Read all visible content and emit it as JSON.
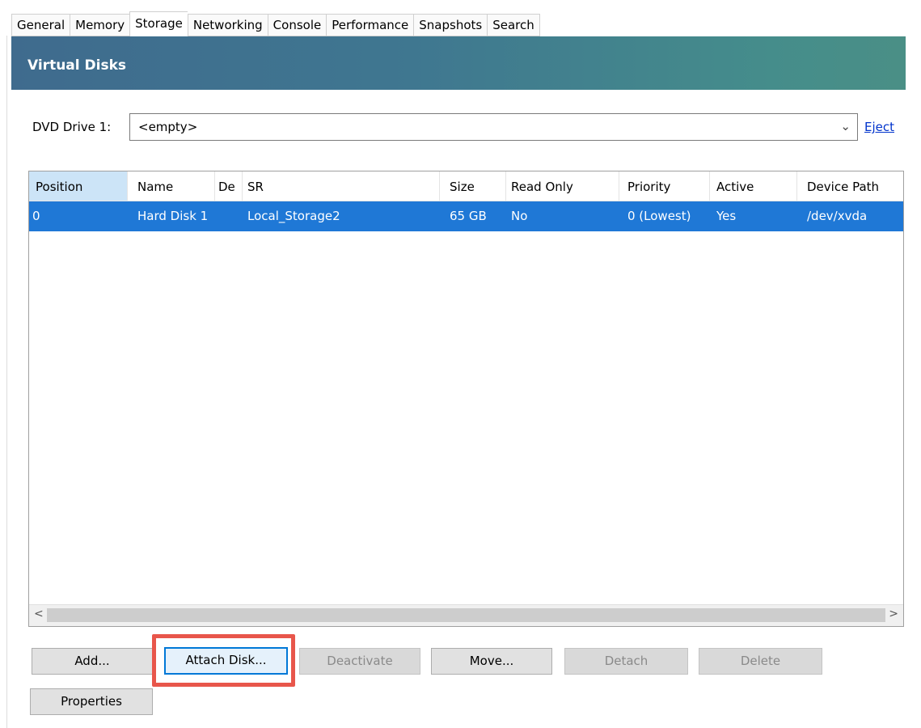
{
  "tabs": [
    {
      "label": "General"
    },
    {
      "label": "Memory"
    },
    {
      "label": "Storage"
    },
    {
      "label": "Networking"
    },
    {
      "label": "Console"
    },
    {
      "label": "Performance"
    },
    {
      "label": "Snapshots"
    },
    {
      "label": "Search"
    }
  ],
  "active_tab": "Storage",
  "banner": {
    "title": "Virtual Disks"
  },
  "dvd": {
    "label": "DVD Drive 1:",
    "value": "<empty>",
    "eject_label": "Eject"
  },
  "table": {
    "columns": [
      "Position",
      "Name",
      "De",
      "SR",
      "Size",
      "Read Only",
      "Priority",
      "Active",
      "Device Path"
    ],
    "sorted_column": "Position",
    "rows": [
      {
        "position": "0",
        "name": "Hard Disk 1",
        "description": "",
        "sr": "Local_Storage2",
        "size": "65 GB",
        "read_only": "No",
        "priority": "0 (Lowest)",
        "active": "Yes",
        "device_path": "/dev/xvda",
        "selected": true
      }
    ]
  },
  "scrollbar": {
    "left_arrow": "<",
    "right_arrow": ">"
  },
  "buttons": {
    "add": "Add...",
    "attach_disk": "Attach Disk...",
    "deactivate": "Deactivate",
    "move": "Move...",
    "detach": "Detach",
    "delete": "Delete",
    "properties": "Properties"
  },
  "colors": {
    "selection": "#1f78d6",
    "highlight_annotation": "#e8564b",
    "link": "#0033cc",
    "banner_start": "#3f6b8e",
    "banner_end": "#4a8f86"
  }
}
